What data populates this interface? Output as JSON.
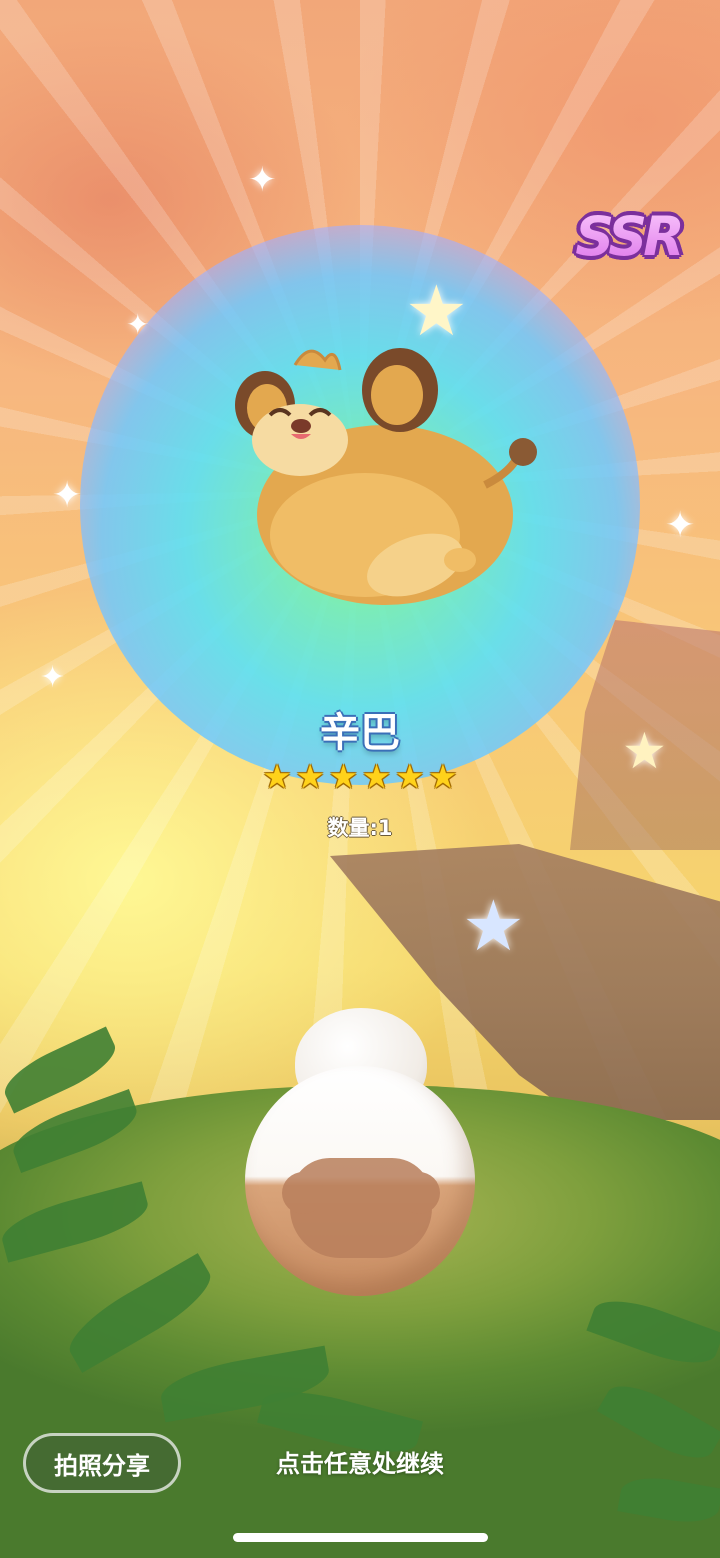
{
  "card": {
    "rarity": "SSR",
    "name": "辛巴",
    "star_count": 6,
    "stars": [
      "★",
      "★",
      "★",
      "★",
      "★",
      "★"
    ],
    "quantity_label": "数量:1"
  },
  "actions": {
    "share_label": "拍照分享",
    "continue_hint": "点击任意处继续"
  },
  "colors": {
    "name_outline": "#3a6fb8",
    "star": "#ffd21a",
    "ssr": "#e07cf0"
  }
}
